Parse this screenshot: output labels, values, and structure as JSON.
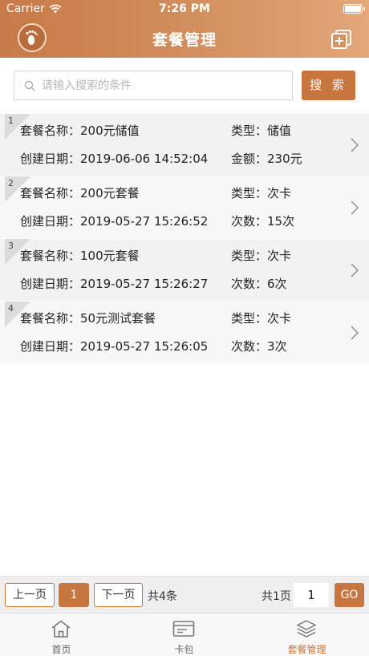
{
  "status": {
    "carrier": "Carrier",
    "time": "7:26 PM"
  },
  "header": {
    "title": "套餐管理"
  },
  "search": {
    "placeholder": "请输入搜索的条件",
    "button_label": "搜 索"
  },
  "records": [
    {
      "index": "1",
      "name": "套餐名称：200元储值",
      "type": "类型：储值",
      "date": "创建日期：2019-06-06 14:52:04",
      "extra": "金额：230元"
    },
    {
      "index": "2",
      "name": "套餐名称：200元套餐",
      "type": "类型：次卡",
      "date": "创建日期：2019-05-27 15:26:52",
      "extra": "次数：15次"
    },
    {
      "index": "3",
      "name": "套餐名称：100元套餐",
      "type": "类型：次卡",
      "date": "创建日期：2019-05-27 15:26:27",
      "extra": "次数：6次"
    },
    {
      "index": "4",
      "name": "套餐名称：50元测试套餐",
      "type": "类型：次卡",
      "date": "创建日期：2019-05-27 15:26:05",
      "extra": "次数：3次"
    }
  ],
  "pager": {
    "prev_label": "上一页",
    "current_page": "1",
    "next_label": "下一页",
    "total_label": "共4条",
    "pages_label": "共1页",
    "page_input_value": "1",
    "go_label": "GO"
  },
  "tabs": [
    {
      "label": "首页",
      "icon": "home-icon"
    },
    {
      "label": "卡包",
      "icon": "card-icon"
    },
    {
      "label": "套餐管理",
      "icon": "layers-icon"
    }
  ],
  "colors": {
    "accent": "#c8763f",
    "header_start": "#c87a48",
    "header_end": "#e3a77a"
  }
}
